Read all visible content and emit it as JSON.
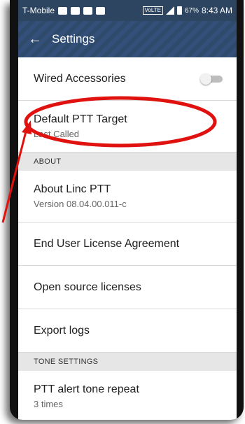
{
  "status_bar": {
    "carrier": "T-Mobile",
    "volte": "VoLTE",
    "network": "LTE",
    "battery": "67%",
    "time": "8:43 AM"
  },
  "toolbar": {
    "back_icon": "arrow-left-icon",
    "title": "Settings"
  },
  "settings": {
    "wired_accessories": {
      "title": "Wired Accessories",
      "toggle_on": false
    },
    "default_ptt_target": {
      "title": "Default PTT Target",
      "subtitle": "Last Called"
    },
    "about_header": "ABOUT",
    "about_app": {
      "title": "About Linc PTT",
      "subtitle": "Version 08.04.00.011-c"
    },
    "eula": {
      "title": "End User License Agreement"
    },
    "open_source": {
      "title": "Open source licenses"
    },
    "export_logs": {
      "title": "Export logs"
    },
    "tone_header": "TONE SETTINGS",
    "ptt_alert_tone": {
      "title": "PTT alert tone repeat",
      "subtitle": "3 times"
    }
  },
  "annotation": {
    "color": "#e0120f"
  }
}
